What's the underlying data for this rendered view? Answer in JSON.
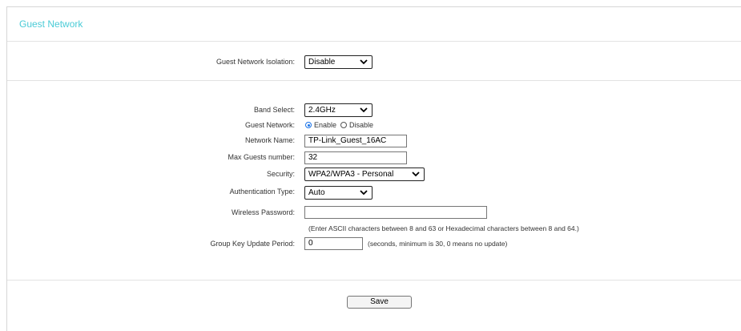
{
  "title": "Guest Network",
  "isolation": {
    "label": "Guest Network Isolation:",
    "value": "Disable"
  },
  "band": {
    "label": "Band Select:",
    "value": "2.4GHz"
  },
  "guest_network": {
    "label": "Guest Network:",
    "enable_label": "Enable",
    "disable_label": "Disable",
    "selected": "Enable"
  },
  "network_name": {
    "label": "Network Name:",
    "value": "TP-Link_Guest_16AC"
  },
  "max_guests": {
    "label": "Max Guests number:",
    "value": "32"
  },
  "security": {
    "label": "Security:",
    "value": "WPA2/WPA3 - Personal"
  },
  "auth_type": {
    "label": "Authentication Type:",
    "value": "Auto"
  },
  "password": {
    "label": "Wireless Password:",
    "value": "",
    "hint": "(Enter ASCII characters between 8 and 63 or Hexadecimal characters between 8 and 64.)"
  },
  "group_key": {
    "label": "Group Key Update Period:",
    "value": "0",
    "hint": "(seconds, minimum is 30, 0 means no update)"
  },
  "save_label": "Save",
  "colors": {
    "accent": "#4acbd6",
    "radio": "#1a73e8"
  }
}
